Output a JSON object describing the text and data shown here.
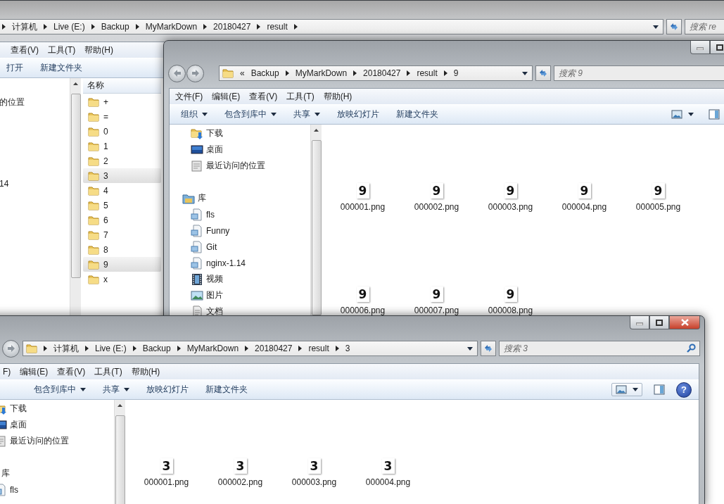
{
  "background_window": {
    "address": {
      "crumbs": [
        "计算机",
        "Live (E:)",
        "Backup",
        "MyMarkDown",
        "20180427",
        "result"
      ],
      "trailing_separator": true
    },
    "search": {
      "placeholder": "搜索 re"
    },
    "menu": [
      "查看(V)",
      "工具(T)",
      "帮助(H)"
    ],
    "toolbar": [
      {
        "label": "打开",
        "dropdown": false
      },
      {
        "label": "新建文件夹",
        "dropdown": false
      }
    ],
    "nav": [
      {
        "items": [
          {
            "label": "的位置",
            "kind": "plain"
          }
        ]
      },
      {
        "items": [
          {
            "label": "14",
            "kind": "plain"
          }
        ]
      }
    ],
    "list": {
      "column": "名称",
      "folders": [
        {
          "name": "+",
          "selected": false
        },
        {
          "name": "=",
          "selected": false
        },
        {
          "name": "0",
          "selected": false
        },
        {
          "name": "1",
          "selected": false
        },
        {
          "name": "2",
          "selected": false
        },
        {
          "name": "3",
          "selected": true
        },
        {
          "name": "4",
          "selected": false
        },
        {
          "name": "5",
          "selected": false
        },
        {
          "name": "6",
          "selected": false
        },
        {
          "name": "7",
          "selected": false
        },
        {
          "name": "8",
          "selected": false
        },
        {
          "name": "9",
          "selected": true
        },
        {
          "name": "x",
          "selected": false
        }
      ]
    }
  },
  "middle_window": {
    "caption_buttons": [
      {
        "kind": "minimize"
      },
      {
        "kind": "maximize"
      }
    ],
    "nav_buttons": [
      {
        "kind": "back"
      },
      {
        "kind": "forward"
      }
    ],
    "address": {
      "folder_icon": true,
      "overflow": "«",
      "crumbs": [
        "Backup",
        "MyMarkDown",
        "20180427",
        "result",
        "9"
      ]
    },
    "search": {
      "placeholder": "搜索 9"
    },
    "menu": [
      "文件(F)",
      "编辑(E)",
      "查看(V)",
      "工具(T)",
      "帮助(H)"
    ],
    "toolbar": [
      {
        "label": "组织",
        "dropdown": true
      },
      {
        "label": "包含到库中",
        "dropdown": true
      },
      {
        "label": "共享",
        "dropdown": true
      },
      {
        "label": "放映幻灯片",
        "dropdown": false
      },
      {
        "label": "新建文件夹",
        "dropdown": false
      }
    ],
    "tools": [
      {
        "kind": "views"
      },
      {
        "kind": "pane"
      }
    ],
    "nav": [
      {
        "items": [
          {
            "label": "下载",
            "kind": "download"
          },
          {
            "label": "桌面",
            "kind": "desktop"
          },
          {
            "label": "最近访问的位置",
            "kind": "recent"
          }
        ]
      },
      {
        "items": [
          {
            "label": "库",
            "kind": "library"
          },
          {
            "label": "fls",
            "kind": "library_folder"
          },
          {
            "label": "Funny",
            "kind": "library_folder"
          },
          {
            "label": "Git",
            "kind": "library_folder"
          },
          {
            "label": "nginx-1.14",
            "kind": "library_folder"
          },
          {
            "label": "视频",
            "kind": "video"
          },
          {
            "label": "图片",
            "kind": "picture"
          },
          {
            "label": "文档",
            "kind": "document"
          }
        ]
      }
    ],
    "files": [
      {
        "name": "000001.png",
        "thumb": "9"
      },
      {
        "name": "000002.png",
        "thumb": "9"
      },
      {
        "name": "000003.png",
        "thumb": "9"
      },
      {
        "name": "000004.png",
        "thumb": "9"
      },
      {
        "name": "000005.png",
        "thumb": "9"
      },
      {
        "name": "000006.png",
        "thumb": "9"
      },
      {
        "name": "000007.png",
        "thumb": "9"
      },
      {
        "name": "000008.png",
        "thumb": "9"
      }
    ]
  },
  "front_window": {
    "caption_buttons": [
      {
        "kind": "minimize"
      },
      {
        "kind": "maximize"
      },
      {
        "kind": "close"
      }
    ],
    "nav_buttons": [
      {
        "kind": "forward"
      }
    ],
    "address": {
      "folder_icon": true,
      "crumbs": [
        "计算机",
        "Live (E:)",
        "Backup",
        "MyMarkDown",
        "20180427",
        "result",
        "3"
      ]
    },
    "search": {
      "placeholder": "搜索 3",
      "magnifier": true
    },
    "menu": [
      "F)",
      "编辑(E)",
      "查看(V)",
      "工具(T)",
      "帮助(H)"
    ],
    "toolbar": [
      {
        "label": "包含到库中",
        "dropdown": true
      },
      {
        "label": "共享",
        "dropdown": true
      },
      {
        "label": "放映幻灯片",
        "dropdown": false
      },
      {
        "label": "新建文件夹",
        "dropdown": false
      }
    ],
    "tools": [
      {
        "kind": "views"
      },
      {
        "kind": "pane"
      },
      {
        "kind": "help",
        "glyph": "?"
      }
    ],
    "nav": [
      {
        "items": [
          {
            "label": "下载",
            "kind": "download"
          },
          {
            "label": "桌面",
            "kind": "desktop"
          },
          {
            "label": "最近访问的位置",
            "kind": "recent"
          }
        ]
      },
      {
        "items": [
          {
            "label": "库",
            "kind": "section"
          },
          {
            "label": "fls",
            "kind": "library_folder"
          }
        ]
      }
    ],
    "files": [
      {
        "name": "000001.png",
        "thumb": "3"
      },
      {
        "name": "000002.png",
        "thumb": "3"
      },
      {
        "name": "000003.png",
        "thumb": "3"
      },
      {
        "name": "000004.png",
        "thumb": "3"
      }
    ]
  }
}
